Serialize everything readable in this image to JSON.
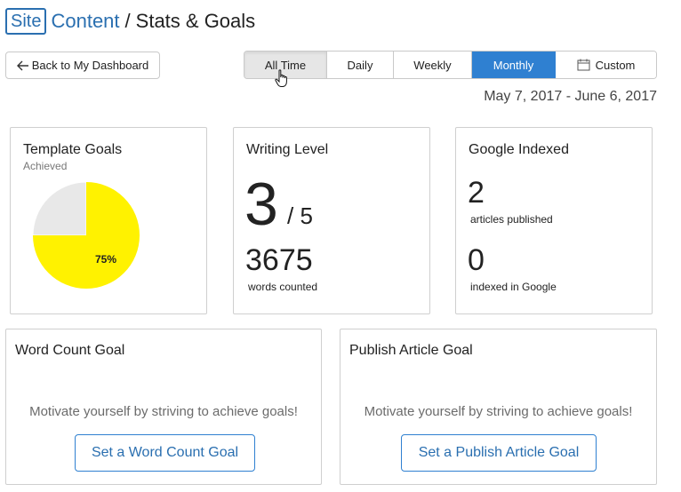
{
  "header": {
    "logo_box": "Site",
    "logo_word": "Content",
    "separator": "/",
    "title": "Stats & Goals"
  },
  "back_button": {
    "label": "Back to My Dashboard",
    "icon": "arrow-left-icon"
  },
  "period_tabs": [
    {
      "label": "All Time",
      "state": "pressed"
    },
    {
      "label": "Daily",
      "state": "normal"
    },
    {
      "label": "Weekly",
      "state": "normal"
    },
    {
      "label": "Monthly",
      "state": "active"
    },
    {
      "label": "Custom",
      "state": "normal",
      "icon": "calendar-icon"
    }
  ],
  "date_range": "May 7, 2017 - June 6, 2017",
  "template_goals": {
    "title": "Template Goals",
    "subtitle": "Achieved",
    "percent_label": "75%",
    "achieved_fraction": 0.75,
    "achieved_color": "#fff200",
    "remaining_color": "#e8e8e8"
  },
  "writing_level": {
    "title": "Writing Level",
    "level": "3",
    "max": "/ 5",
    "words": "3675",
    "words_label": "words counted"
  },
  "google_indexed": {
    "title": "Google Indexed",
    "published": "2",
    "published_label": "articles published",
    "indexed": "0",
    "indexed_label": "indexed in Google"
  },
  "word_count_goal": {
    "title": "Word Count Goal",
    "message": "Motivate yourself by striving to achieve goals!",
    "button": "Set a Word Count Goal"
  },
  "publish_goal": {
    "title": "Publish Article Goal",
    "message": "Motivate yourself by striving to achieve goals!",
    "button": "Set a Publish Article Goal"
  },
  "colors": {
    "accent": "#2f80d1",
    "brand": "#2a6fb0"
  }
}
